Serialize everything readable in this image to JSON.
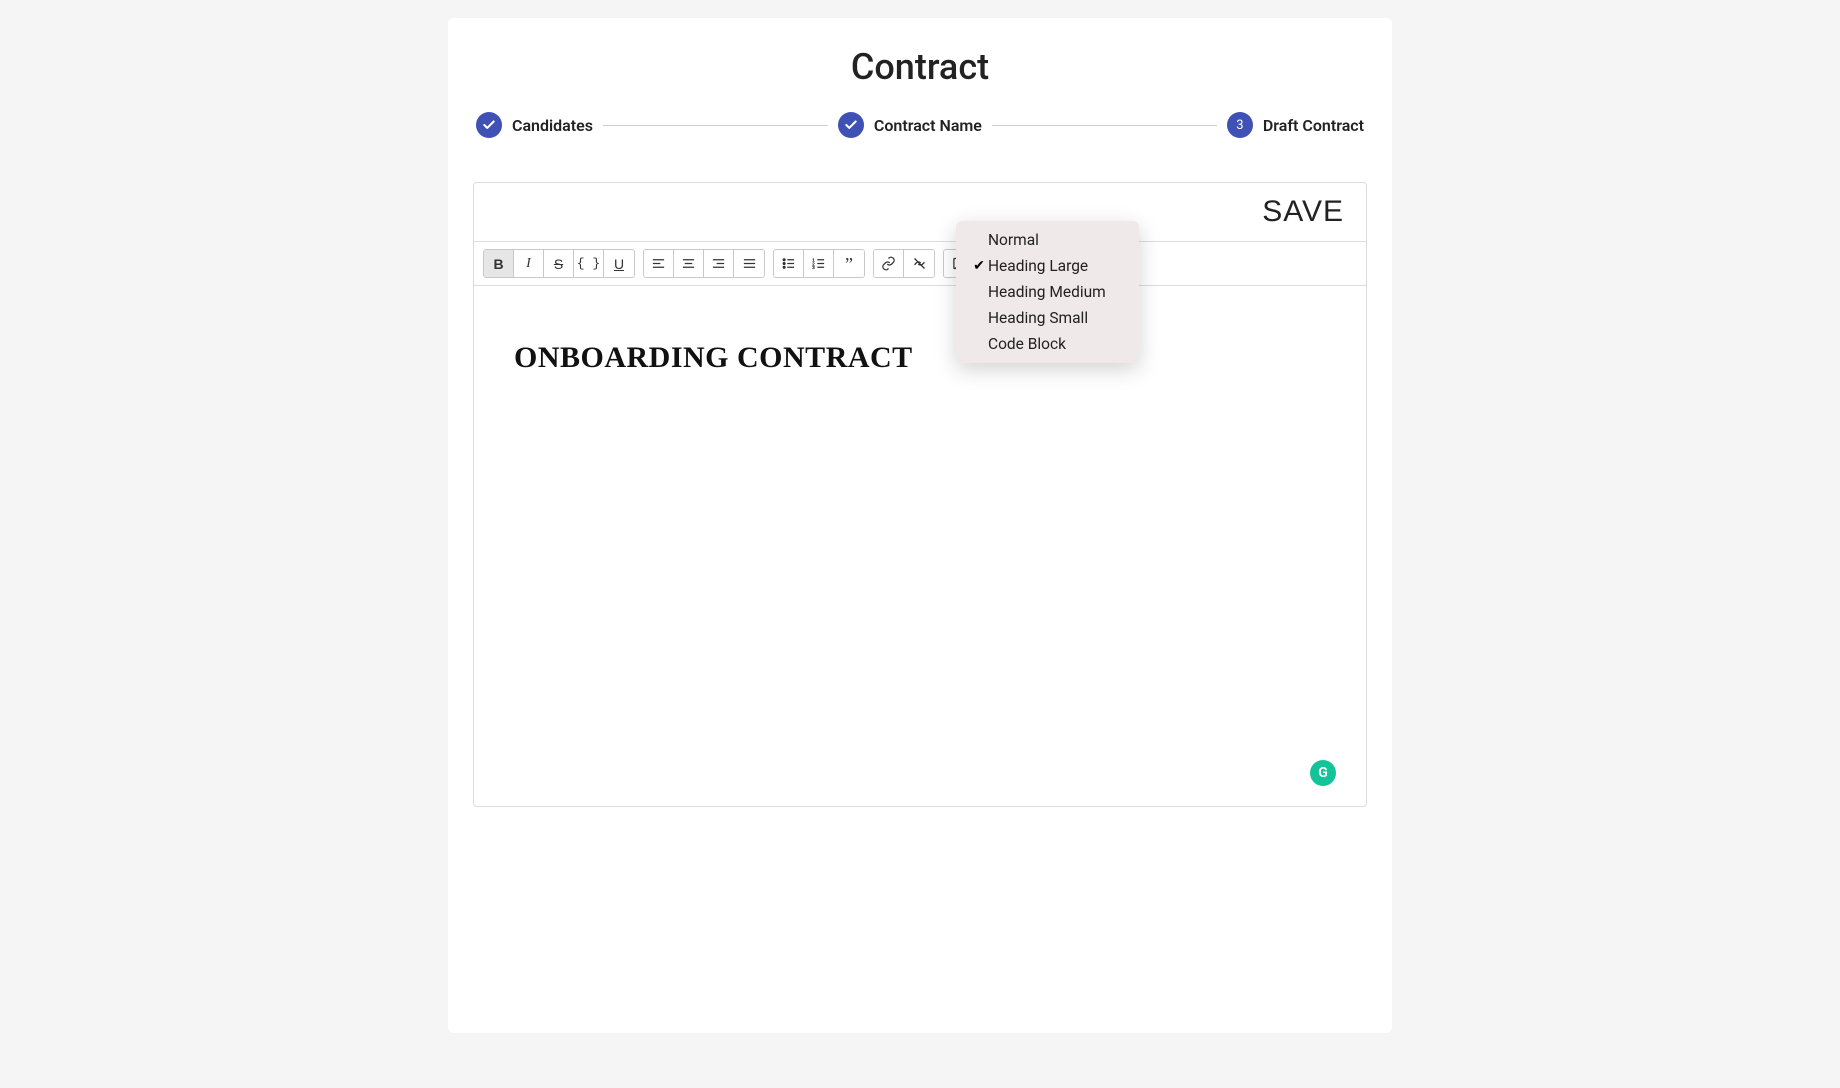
{
  "page": {
    "title": "Contract"
  },
  "stepper": {
    "steps": [
      {
        "label": "Candidates",
        "done": true
      },
      {
        "label": "Contract Name",
        "done": true
      },
      {
        "label": "Draft Contract",
        "number": "3"
      }
    ]
  },
  "editor": {
    "save_label": "SAVE",
    "document": {
      "heading": "ONBOARDING CONTRACT"
    },
    "heading_dropdown": {
      "selected": "Heading Large",
      "options": [
        {
          "label": "Normal"
        },
        {
          "label": "Heading Large"
        },
        {
          "label": "Heading Medium"
        },
        {
          "label": "Heading Small"
        },
        {
          "label": "Code Block"
        }
      ]
    }
  },
  "grammarly": {
    "label": "G"
  }
}
